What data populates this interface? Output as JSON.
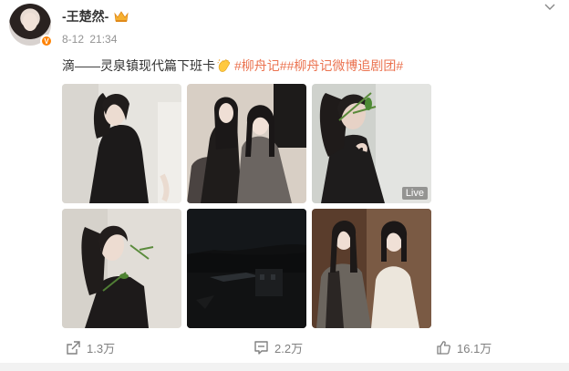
{
  "post": {
    "username": "-王楚然-",
    "date": "8-12",
    "time": "21:34",
    "text_prefix": "滴——灵泉镇现代篇下班卡",
    "tags": [
      "#柳舟记#",
      "#柳舟记微博追剧团#"
    ],
    "live_label": "Live"
  },
  "actions": {
    "share_count": "1.3万",
    "comment_count": "2.2万",
    "like_count": "16.1万"
  },
  "icons": {
    "verified": "verified-badge-icon",
    "crown": "crown-icon",
    "more": "chevron-down-icon",
    "clap": "clapping-hands-emoji",
    "share": "share-icon",
    "comment": "comment-icon",
    "like": "thumbs-up-icon"
  },
  "colors": {
    "tag": "#eb7350",
    "badge": "#ff8200",
    "muted": "#808080"
  },
  "verified_label": "V"
}
